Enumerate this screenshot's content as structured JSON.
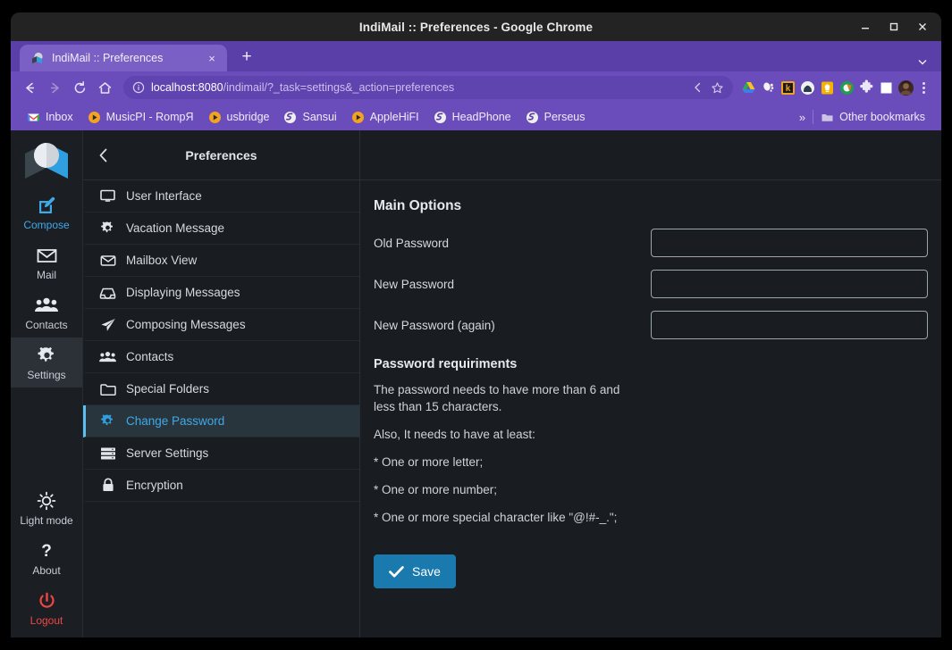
{
  "window": {
    "title": "IndiMail :: Preferences - Google Chrome",
    "controls": {
      "minimize": "minimize-icon",
      "maximize": "maximize-icon",
      "close": "close-icon"
    }
  },
  "browser": {
    "tab": {
      "title": "IndiMail :: Preferences",
      "favicon": "indimail-favicon",
      "close_label": "×"
    },
    "new_tab_label": "+",
    "tabstrip_menu_label": "⌄",
    "nav": {
      "back": "←",
      "forward": "→",
      "reload": "⟳",
      "home": "⌂"
    },
    "omnibox": {
      "info_icon": "info-circle-icon",
      "url_host": "localhost:8080",
      "url_path": "/indimail/?_task=settings&_action=preferences",
      "share_icon": "share-icon",
      "bookmark_icon": "star-icon"
    },
    "extensions": [
      "google-drive-icon",
      "gnome-foot-icon",
      "k-badge-icon",
      "helmet-icon",
      "lightbulb-icon",
      "ring-icon",
      "puzzle-extensions-icon",
      "square-icon",
      "profile-avatar",
      "chrome-menu-icon"
    ],
    "bookmarks": [
      {
        "label": "Inbox",
        "icon": "gmail-icon"
      },
      {
        "label": "MusicPI - RompЯ",
        "icon": "play-circle-icon"
      },
      {
        "label": "usbridge",
        "icon": "play-circle-icon"
      },
      {
        "label": "Sansui",
        "icon": "globe-icon"
      },
      {
        "label": "AppleHiFI",
        "icon": "play-circle-icon"
      },
      {
        "label": "HeadPhone",
        "icon": "globe-icon"
      },
      {
        "label": "Perseus",
        "icon": "globe-icon"
      }
    ],
    "bookmarks_overflow": "»",
    "other_bookmarks": {
      "label": "Other bookmarks",
      "icon": "folder-icon"
    }
  },
  "rail": {
    "logo": "indimail-logo",
    "items": [
      {
        "label": "Compose",
        "icon": "compose-pencil-icon",
        "accent": true,
        "active": false
      },
      {
        "label": "Mail",
        "icon": "envelope-icon",
        "accent": false,
        "active": false
      },
      {
        "label": "Contacts",
        "icon": "people-icon",
        "accent": false,
        "active": false
      },
      {
        "label": "Settings",
        "icon": "gear-icon",
        "accent": false,
        "active": true
      }
    ],
    "bottom_items": [
      {
        "label": "Light mode",
        "icon": "sun-icon",
        "danger": false
      },
      {
        "label": "About",
        "icon": "question-mark-icon",
        "danger": false
      },
      {
        "label": "Logout",
        "icon": "power-icon",
        "danger": true
      }
    ]
  },
  "prefs": {
    "back_icon": "chevron-left-icon",
    "title": "Preferences",
    "items": [
      {
        "label": "User Interface",
        "icon": "monitor-icon",
        "selected": false
      },
      {
        "label": "Vacation Message",
        "icon": "gear-icon",
        "selected": false
      },
      {
        "label": "Mailbox View",
        "icon": "envelope-icon",
        "selected": false
      },
      {
        "label": "Displaying Messages",
        "icon": "inbox-icon",
        "selected": false
      },
      {
        "label": "Composing Messages",
        "icon": "paper-plane-icon",
        "selected": false
      },
      {
        "label": "Contacts",
        "icon": "people-icon",
        "selected": false
      },
      {
        "label": "Special Folders",
        "icon": "folder-icon",
        "selected": false
      },
      {
        "label": "Change Password",
        "icon": "gear-icon",
        "selected": true
      },
      {
        "label": "Server Settings",
        "icon": "server-icon",
        "selected": false
      },
      {
        "label": "Encryption",
        "icon": "lock-icon",
        "selected": false
      }
    ]
  },
  "main": {
    "section_title": "Main Options",
    "fields": [
      {
        "label": "Old Password",
        "value": "",
        "placeholder": ""
      },
      {
        "label": "New Password",
        "value": "",
        "placeholder": ""
      },
      {
        "label": "New Password (again)",
        "value": "",
        "placeholder": ""
      }
    ],
    "requirements_title": "Password requiriments",
    "requirements": [
      "The password needs to have more than 6 and less than 15 characters.",
      "Also, It needs to have at least:",
      "* One or more letter;",
      "* One or more number;",
      "* One or more special character like \"@!#-_.\";"
    ],
    "save_label": "Save",
    "save_icon": "check-icon",
    "save_color": "#1a7aad"
  },
  "theme": {
    "accent": "#3fa9e8",
    "chrome_purple": "#6a4cbb",
    "panel_bg": "#191c20",
    "danger": "#ef4545"
  }
}
